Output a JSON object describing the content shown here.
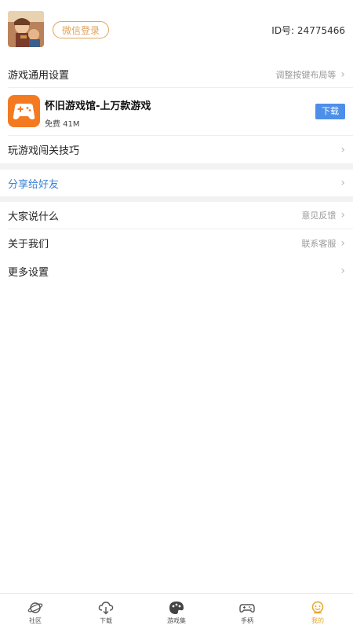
{
  "header": {
    "login_label": "微信登录",
    "user_id": "ID号: 24775466"
  },
  "settings": {
    "general": {
      "label": "游戏通用设置",
      "hint": "调整按键布局等"
    }
  },
  "app": {
    "title": "怀旧游戏馆-上万款游戏",
    "subtitle": "免费 41M",
    "download_label": "下载",
    "accent": "#f47a22",
    "button_color": "#4d8fe8"
  },
  "tips": {
    "label": "玩游戏闯关技巧"
  },
  "share": {
    "label": "分享给好友",
    "color": "#3b7fd6"
  },
  "community": {
    "label": "大家说什么",
    "hint": "意见反馈"
  },
  "about": {
    "label": "关于我们",
    "hint": "联系客服"
  },
  "more": {
    "label": "更多设置"
  },
  "tabs": [
    {
      "label": "社区",
      "icon": "planet-icon"
    },
    {
      "label": "下载",
      "icon": "cloud-download-icon"
    },
    {
      "label": "游戏集",
      "icon": "palette-icon"
    },
    {
      "label": "手柄",
      "icon": "gamepad-icon"
    },
    {
      "label": "我的",
      "icon": "face-icon",
      "active": true
    }
  ],
  "active_color": "#e6a82b"
}
